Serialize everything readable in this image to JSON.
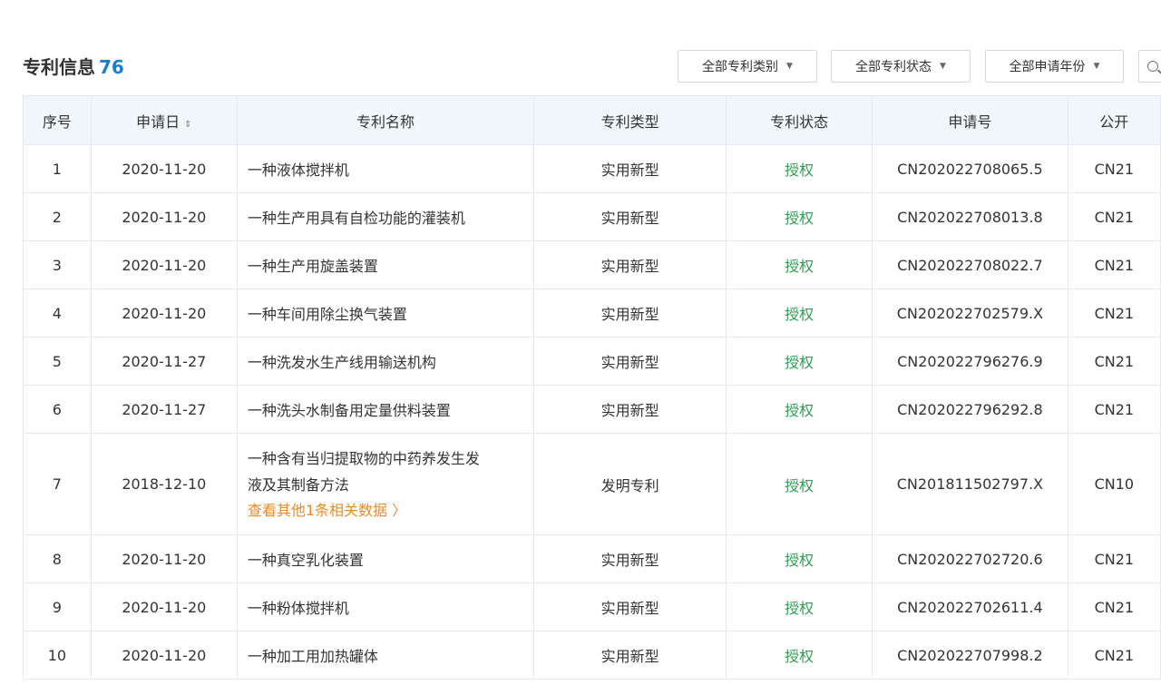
{
  "header": {
    "title": "专利信息",
    "count": "76",
    "filters": [
      {
        "label": "全部专利类别",
        "icon": "caret-down-icon"
      },
      {
        "label": "全部专利状态",
        "icon": "caret-down-icon"
      },
      {
        "label": "全部申请年份",
        "icon": "caret-down-icon"
      }
    ],
    "search_icon": "search-icon"
  },
  "table": {
    "columns": [
      "序号",
      "申请日",
      "专利名称",
      "专利类型",
      "专利状态",
      "申请号",
      "公开"
    ],
    "sort_icon": "sort-icon",
    "rows": [
      {
        "index": "1",
        "date": "2020-11-20",
        "name": "一种液体搅拌机",
        "type": "实用新型",
        "status": "授权",
        "app_no": "CN202022708065.5",
        "pub": "CN21"
      },
      {
        "index": "2",
        "date": "2020-11-20",
        "name": "一种生产用具有自检功能的灌装机",
        "type": "实用新型",
        "status": "授权",
        "app_no": "CN202022708013.8",
        "pub": "CN21"
      },
      {
        "index": "3",
        "date": "2020-11-20",
        "name": "一种生产用旋盖装置",
        "type": "实用新型",
        "status": "授权",
        "app_no": "CN202022708022.7",
        "pub": "CN21"
      },
      {
        "index": "4",
        "date": "2020-11-20",
        "name": "一种车间用除尘换气装置",
        "type": "实用新型",
        "status": "授权",
        "app_no": "CN202022702579.X",
        "pub": "CN21"
      },
      {
        "index": "5",
        "date": "2020-11-27",
        "name": "一种洗发水生产线用输送机构",
        "type": "实用新型",
        "status": "授权",
        "app_no": "CN202022796276.9",
        "pub": "CN21"
      },
      {
        "index": "6",
        "date": "2020-11-27",
        "name": "一种洗头水制备用定量供料装置",
        "type": "实用新型",
        "status": "授权",
        "app_no": "CN202022796292.8",
        "pub": "CN21"
      },
      {
        "index": "7",
        "date": "2018-12-10",
        "name_line1": "一种含有当归提取物的中药养发生发",
        "name_line2": "液及其制备方法",
        "related_link": "查看其他1条相关数据 〉",
        "type": "发明专利",
        "status": "授权",
        "app_no": "CN201811502797.X",
        "pub": "CN10"
      },
      {
        "index": "8",
        "date": "2020-11-20",
        "name": "一种真空乳化装置",
        "type": "实用新型",
        "status": "授权",
        "app_no": "CN202022702720.6",
        "pub": "CN21"
      },
      {
        "index": "9",
        "date": "2020-11-20",
        "name": "一种粉体搅拌机",
        "type": "实用新型",
        "status": "授权",
        "app_no": "CN202022702611.4",
        "pub": "CN21"
      },
      {
        "index": "10",
        "date": "2020-11-20",
        "name": "一种加工用加热罐体",
        "type": "实用新型",
        "status": "授权",
        "app_no": "CN202022707998.2",
        "pub": "CN21"
      }
    ]
  },
  "colors": {
    "accent": "#1a7fd4",
    "status_green": "#2e9e52",
    "link_orange": "#f08a24",
    "header_bg": "#f1f6fb",
    "border": "#e6eaf0"
  }
}
